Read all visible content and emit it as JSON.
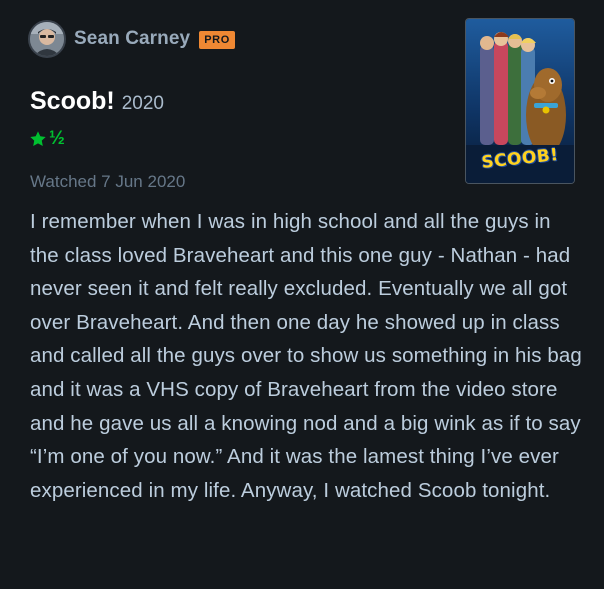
{
  "reviewer": {
    "name": "Sean Carney",
    "badge": "PRO"
  },
  "film": {
    "title": "Scoob!",
    "year": "2020",
    "poster_title": "SCOOB!"
  },
  "rating": {
    "stars": 1.5,
    "half_symbol": "½",
    "star_color": "#00c030"
  },
  "watched": {
    "text": "Watched 7 Jun 2020"
  },
  "review": {
    "text": "I remember when I was in high school and all the guys in the class loved Braveheart and this one guy - Nathan - had never seen it and felt really excluded. Eventually we all got over Braveheart. And then one day he showed up in class and called all the guys over to show us something in his bag and it was a VHS copy of Braveheart from the video store and he gave us all a knowing nod and a big wink as if to say “I’m one of you now.” And it was the lamest thing I’ve ever experienced in my life. Anyway, I watched Scoob tonight."
  },
  "colors": {
    "background": "#14181c",
    "pro_badge": "#ef8833",
    "username": "#99aabb",
    "body_text": "#bccddd"
  },
  "icons": {
    "avatar": "user-avatar",
    "star": "star-icon"
  }
}
